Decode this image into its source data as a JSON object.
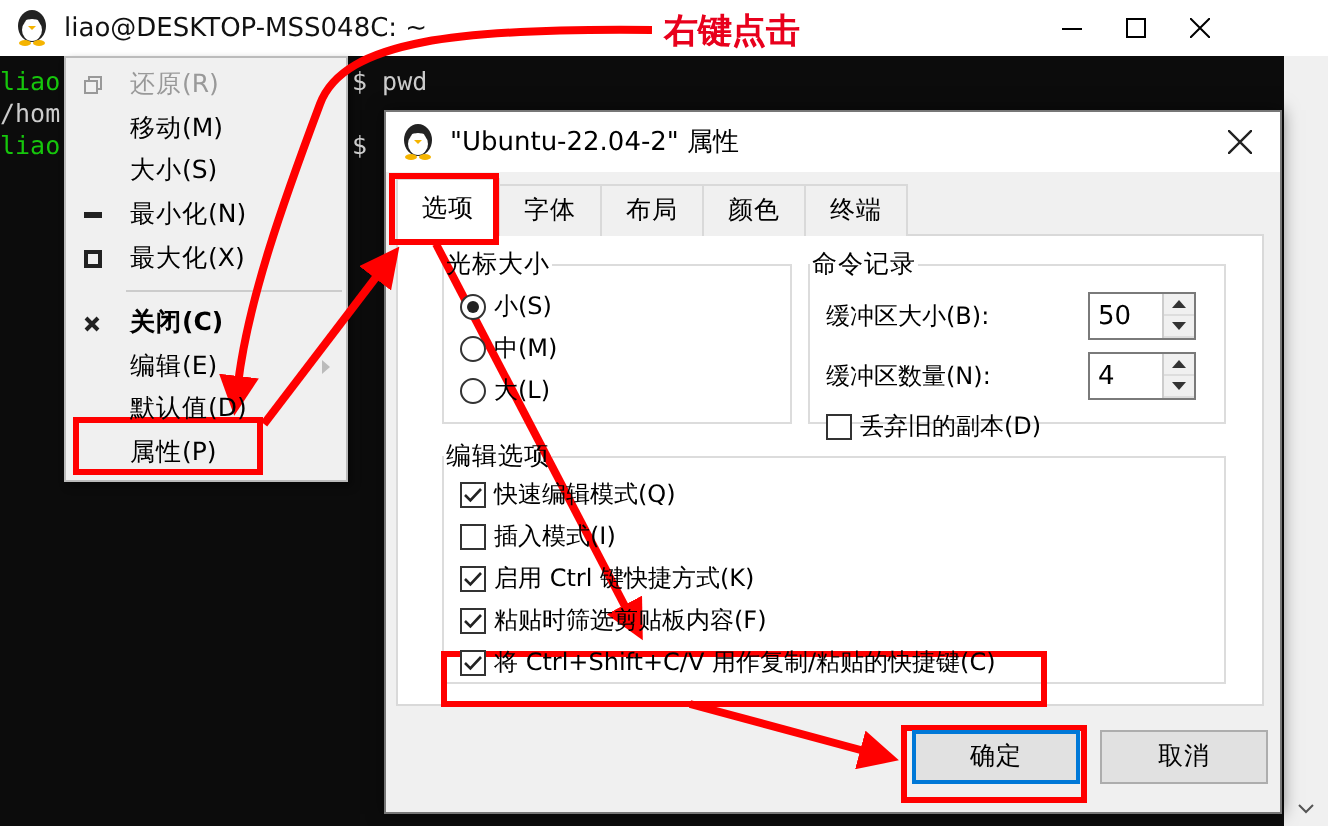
{
  "terminal": {
    "title": "liao@DESKTOP-MSS048C: ~",
    "lines": [
      {
        "segments": [
          {
            "text": "liao",
            "kind": "prompt"
          },
          {
            "text": "$ pwd",
            "kind": "output"
          }
        ]
      },
      {
        "segments": [
          {
            "text": "/hom",
            "kind": "output"
          }
        ]
      },
      {
        "segments": [
          {
            "text": "liao",
            "kind": "prompt"
          },
          {
            "text": "$",
            "kind": "output"
          }
        ]
      }
    ]
  },
  "system_menu": [
    {
      "kind": "restore",
      "label": "还原(R)",
      "disabled": true,
      "default": false,
      "submenu": false
    },
    {
      "kind": "plain",
      "label": "移动(M)",
      "disabled": false,
      "default": false,
      "submenu": false
    },
    {
      "kind": "plain",
      "label": "大小(S)",
      "disabled": false,
      "default": false,
      "submenu": false
    },
    {
      "kind": "minimize",
      "label": "最小化(N)",
      "disabled": false,
      "default": false,
      "submenu": false
    },
    {
      "kind": "maximize",
      "label": "最大化(X)",
      "disabled": false,
      "default": false,
      "submenu": false
    },
    {
      "kind": "separator"
    },
    {
      "kind": "close",
      "label": "关闭(C)",
      "disabled": false,
      "default": true,
      "submenu": false
    },
    {
      "kind": "plain",
      "label": "编辑(E)",
      "disabled": false,
      "default": false,
      "submenu": true
    },
    {
      "kind": "plain",
      "label": "默认值(D)",
      "disabled": false,
      "default": false,
      "submenu": false
    },
    {
      "kind": "plain",
      "label": "属性(P)",
      "disabled": false,
      "default": false,
      "submenu": false
    }
  ],
  "dialog": {
    "title": "\"Ubuntu-22.04-2\" 属性",
    "tabs": [
      {
        "label": "选项",
        "selected": true
      },
      {
        "label": "字体",
        "selected": false
      },
      {
        "label": "布局",
        "selected": false
      },
      {
        "label": "颜色",
        "selected": false
      },
      {
        "label": "终端",
        "selected": false
      }
    ],
    "cursor_size": {
      "title": "光标大小",
      "options": [
        {
          "label": "小(S)",
          "selected": true
        },
        {
          "label": "中(M)",
          "selected": false
        },
        {
          "label": "大(L)",
          "selected": false
        }
      ]
    },
    "command_history": {
      "title": "命令记录",
      "fields": [
        {
          "label": "缓冲区大小(B):",
          "value": "50"
        },
        {
          "label": "缓冲区数量(N):",
          "value": "4"
        }
      ],
      "discard_old": {
        "label": "丢弃旧的副本(D)",
        "checked": false
      }
    },
    "edit_options": {
      "title": "编辑选项",
      "options": [
        {
          "label": "快速编辑模式(Q)",
          "checked": true
        },
        {
          "label": "插入模式(I)",
          "checked": false
        },
        {
          "label": "启用 Ctrl 键快捷方式(K)",
          "checked": true
        },
        {
          "label": "粘贴时筛选剪贴板内容(F)",
          "checked": true
        },
        {
          "label": "将 Ctrl+Shift+C/V 用作复制/粘贴的快捷键(C)",
          "checked": true
        }
      ]
    },
    "buttons": [
      {
        "label": "确定",
        "default": true
      },
      {
        "label": "取消",
        "default": false
      }
    ]
  },
  "annotation": {
    "callout": "右键点击"
  }
}
